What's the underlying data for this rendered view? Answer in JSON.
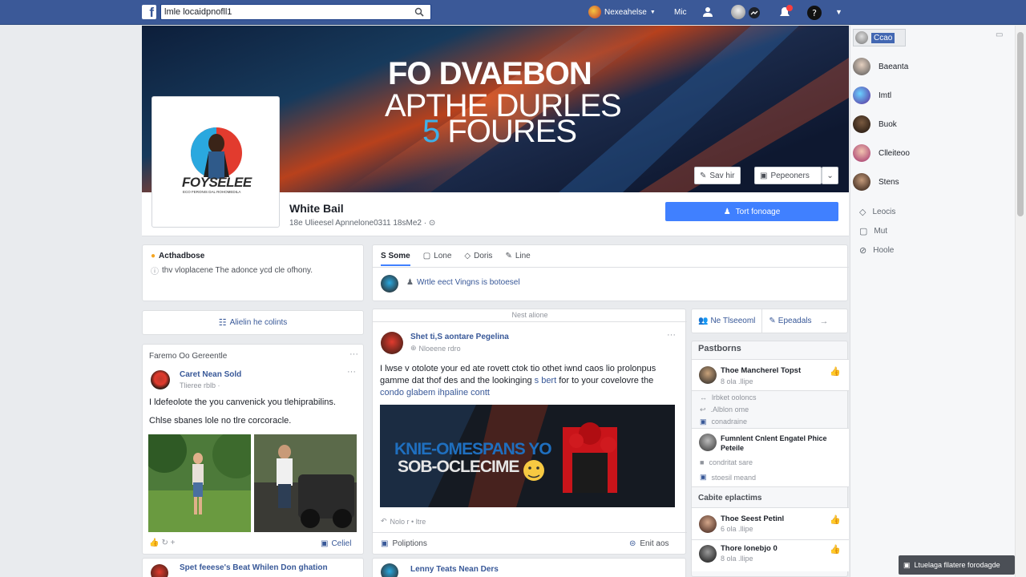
{
  "topbar": {
    "search_value": "lmle locaidpnofll1",
    "nav_label": "Nexeahelse",
    "nav_short": "Mic"
  },
  "cover": {
    "line1": "FO DVAEBON",
    "line2": "APTHE DURLES",
    "line3_num": "5",
    "line3": "FOURES",
    "say_hi": "Sav hir",
    "page_button": "Pepeoners",
    "cta_button": "Tort fonoage"
  },
  "profile": {
    "logo_text": "FOYSELEE",
    "logo_sub": "ECO FERONIS DAL ROHOMEDILA",
    "name": "White Bail",
    "subtitle": "18e Ulieesel Apnnelone0311 18sMe2 ·  ⊙"
  },
  "about": {
    "title": "Acthadbose",
    "desc": "thv vloplacene The adonce ycd cle ofhony.",
    "link": "Alielin he colints"
  },
  "left_post": {
    "header": "Faremo Oo  Gereentle",
    "name": "Caret Nean Sold",
    "meta": "Tlieree rblb ·",
    "line1": "I ldefeolote the you canvenick you tlehiprabilins.",
    "line2": "Chlse sbanes lole no tlre corcoracle.",
    "like_label": "Celiel"
  },
  "left_post2": {
    "name": "Spet feeese's Beat Whilen Don ghation"
  },
  "composer": {
    "tabs": [
      "S Some",
      "Lone",
      "Doris",
      "Line"
    ],
    "prompt": "Wrtle eect Vingns is botoesel"
  },
  "feed": {
    "section_label": "Nest alione",
    "post": {
      "name": "Shet ti,S aontare Pegelina",
      "meta": "Nloeene rdro",
      "text1": "I lwse v otolote your ed ate rovett ctok tio othet iwnd caos lio prolonpus",
      "text2a": "gamme dat thof des and the lookinging",
      "text2b": "s bert",
      "text2c": "for to your covelovre the",
      "text3": "condo glabem ihpaline contt",
      "image_text1": "KNIE-OMESPANS YO",
      "image_text2": "SOB-OCLECIME",
      "reactions": "Nolo r • ltre",
      "comment": "Poliptions",
      "share": "Enit aos"
    },
    "post2_name": "Lenny Teats Nean Ders"
  },
  "mid_right": {
    "btn1": "Ne Tlseeoml",
    "btn2": "Epeadals",
    "section1": "Pastborns",
    "item1": "Thoe Mancherel Topst",
    "item1_meta": "8 ola .llipe",
    "list": [
      "lrbket ooloncs",
      ".Alblon ome",
      "conadraine"
    ],
    "item2_line1": "Fumnlent Cnlent Engatel Phice",
    "item2_line2": "Peteile",
    "list2": [
      "condritat sare",
      "stoesil meand"
    ],
    "section2": "Cabite eplactims",
    "item3": "Thoe Seest Petinl",
    "item3_meta": "6 ola .llipe",
    "item4": "Thore lonebjo 0",
    "item4_meta": "8 ola .llipe"
  },
  "sidebar": {
    "top_btn": "Ccao",
    "contacts": [
      "Baeanta",
      "Imtl",
      "Buok",
      "Clleiteoo",
      "Stens"
    ],
    "links": [
      "Leocis",
      "Mut",
      "Hoole"
    ],
    "footer": "Ltuelaga fllatere forodagde"
  },
  "colors": {
    "brand": "#3b5998",
    "cta": "#4080ff",
    "link": "#385898"
  }
}
